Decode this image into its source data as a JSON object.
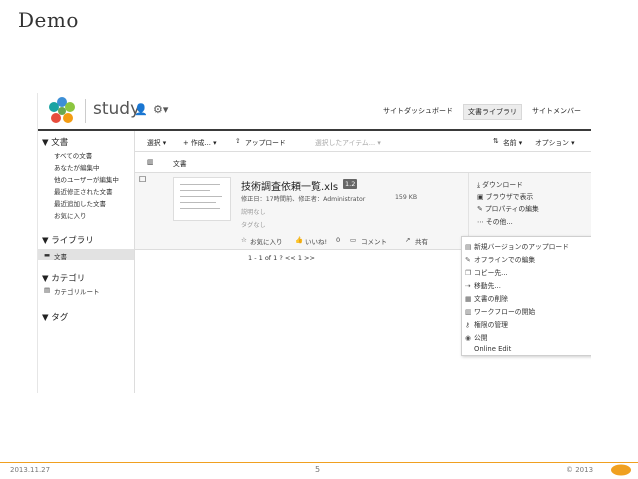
{
  "slide": {
    "title": "Demo",
    "date": "2013.11.27",
    "page": "5",
    "copyright": "© 2013"
  },
  "app": {
    "brand": "study",
    "nav": [
      "サイトダッシュボード",
      "文書ライブラリ",
      "サイトメンバー"
    ]
  },
  "sidebar": {
    "docs_head": "▼ 文書",
    "doc_items": [
      "すべての文書",
      "あなたが編集中",
      "他のユーザーが編集中",
      "最近修正された文書",
      "最近追加した文書",
      "お気に入り"
    ],
    "library_head": "▼ ライブラリ",
    "library_item": "文書",
    "category_head": "▼ カテゴリ",
    "category_item": "カテゴリルート",
    "tag_head": "▼ タグ"
  },
  "toolbar": {
    "select": "選択 ▾",
    "create": "+ 作成... ▾",
    "upload": "アップロード",
    "selected": "選択したアイテム... ▾",
    "sort": "名前 ▾",
    "options": "オプション ▾"
  },
  "breadcrumb": "文書",
  "document": {
    "name": "技術調査依頼一覧.xls",
    "version": "1.2",
    "modified": "修正日：17時間前、修正者：Administrator",
    "size": "159 KB",
    "description": "説明なし",
    "tags": "タグなし",
    "favorite": "お気に入り",
    "like": "いいね!",
    "like_count": "0",
    "comment": "コメント",
    "share": "共有"
  },
  "row_actions": [
    "ダウンロード",
    "ブラウザで表示",
    "プロパティの編集",
    "その他..."
  ],
  "more_menu": [
    {
      "label": "新規バージョンのアップロード",
      "icon": "upload-icon"
    },
    {
      "label": "オフラインでの編集",
      "icon": "pencil-icon"
    },
    {
      "label": "コピー先...",
      "icon": "copy-icon"
    },
    {
      "label": "移動先...",
      "icon": "move-icon"
    },
    {
      "label": "文書の削除",
      "icon": "trash-icon"
    },
    {
      "label": "ワークフローの開始",
      "icon": "workflow-icon"
    },
    {
      "label": "権限の管理",
      "icon": "key-icon"
    },
    {
      "label": "公開",
      "icon": "publish-icon"
    },
    {
      "label": "Online Edit",
      "icon": ""
    }
  ],
  "pager": "1 - 1 of 1 ? <<    1    >>",
  "colors": {
    "accent": "#f0a020",
    "topbar_border": "#3a3a3a"
  }
}
